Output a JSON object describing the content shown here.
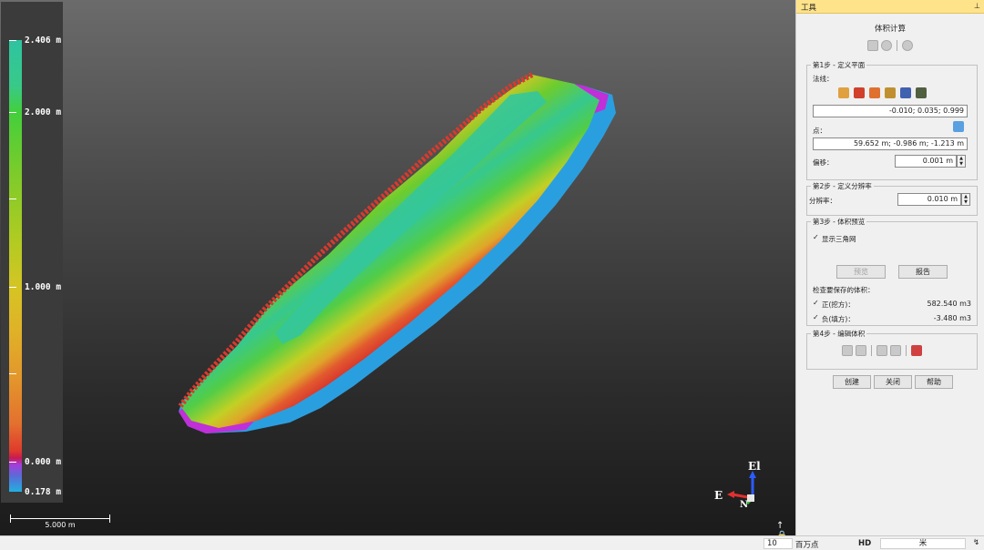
{
  "viewport": {
    "legend": {
      "labels": [
        "2.406 m",
        "2.000 m",
        "1.000 m",
        "0.000 m",
        "0.178 m"
      ]
    },
    "scalebar": {
      "label": "5.000 m"
    },
    "axes": {
      "up": "El",
      "east": "E",
      "north": "N"
    },
    "colors": {
      "red": "#e03a2e",
      "yellow": "#d9d02a",
      "green": "#3fcf57",
      "teal": "#2ec4a0",
      "magenta": "#c02fd8",
      "blue": "#2a9fe0"
    }
  },
  "panel": {
    "header": "工具",
    "title": "体积计算",
    "step1": {
      "legend": "第1步 - 定义平面",
      "normal_label": "法线：",
      "normal_value": "-0.010; 0.035; 0.999",
      "point_label": "点：",
      "point_value": "59.652 m; -0.986 m; -1.213 m",
      "offset_label": "偏移：",
      "offset_value": "0.001 m"
    },
    "step2": {
      "legend": "第2步 - 定义分辨率",
      "resolution_label": "分辨率：",
      "resolution_value": "0.010 m"
    },
    "step3": {
      "legend": "第3步 - 体积预览",
      "show_mesh_label": "显示三角网",
      "preview_button": "预览",
      "report_button": "报告",
      "check_label": "检查要保存的体积：",
      "positive_label": "正(挖方)：",
      "positive_value": "582.540 m3",
      "negative_label": "负(填方)：",
      "negative_value": "-3.480 m3"
    },
    "step4": {
      "legend": "第4步 - 编辑体积"
    },
    "buttons": {
      "create": "创建",
      "close": "关闭",
      "help": "帮助"
    }
  },
  "statusbar": {
    "points_value": "10",
    "points_unit": "百万点",
    "quality": "HD",
    "unit": "米"
  }
}
